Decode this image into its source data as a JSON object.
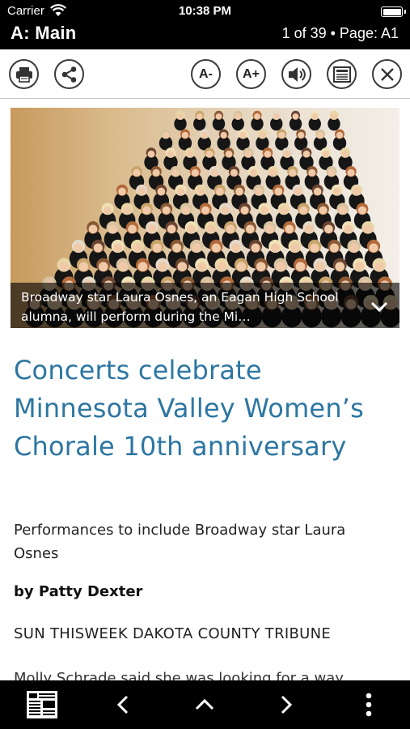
{
  "status": {
    "carrier": "Carrier",
    "time": "10:38 PM"
  },
  "header": {
    "section": "A: Main",
    "page_info": "1 of 39 • Page: A1"
  },
  "toolbar": {
    "print_icon": "printer-icon",
    "share_icon": "share-icon",
    "decrease_font_label": "A-",
    "increase_font_label": "A+",
    "audio_icon": "speaker-icon",
    "page_view_icon": "newspaper-page-icon",
    "close_icon": "close-icon"
  },
  "article": {
    "photo_caption": "Broadway star Laura Osnes, an Eagan High School alumna, will perform during the Mi…",
    "headline": "Concerts celebrate Minnesota Valley Women’s Chorale 10th anniversary",
    "subheadline": "Performances to include Broadway star Laura Osnes",
    "byline": "by Patty Dexter",
    "source": "SUN THISWEEK DAKOTA COUNTY TRIBUNE",
    "body_start": "Molly Schrade said she was looking for a way"
  },
  "bottom_nav": {
    "newspaper_icon": "newspaper-icon",
    "previous_icon": "chevron-left-icon",
    "up_icon": "chevron-up-icon",
    "next_icon": "chevron-right-icon",
    "more_icon": "more-vertical-icon"
  },
  "colors": {
    "headline": "#2d76a2",
    "bars": "#000000"
  }
}
